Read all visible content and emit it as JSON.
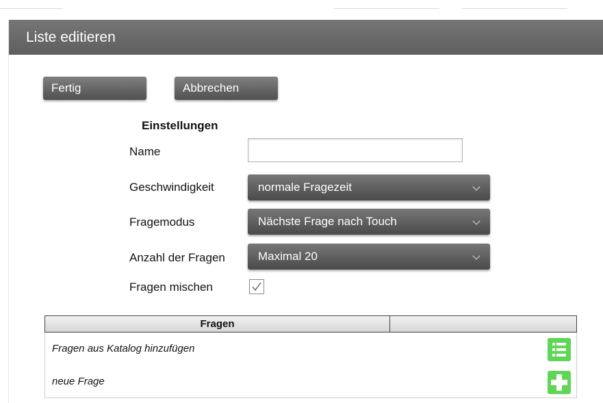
{
  "header": {
    "title": "Liste editieren"
  },
  "actions": {
    "done_label": "Fertig",
    "cancel_label": "Abbrechen"
  },
  "settings": {
    "heading": "Einstellungen",
    "name_label": "Name",
    "name_value": "",
    "speed_label": "Geschwindigkeit",
    "speed_value": "normale Fragezeit",
    "mode_label": "Fragemodus",
    "mode_value": "Nächste Frage nach Touch",
    "count_label": "Anzahl der Fragen",
    "count_value": "Maximal 20",
    "shuffle_label": "Fragen mischen",
    "shuffle_checked": true
  },
  "questions_table": {
    "column_header": "Fragen",
    "second_header": "",
    "rows": [
      {
        "label": "Fragen aus Katalog hinzufügen",
        "icon": "list-icon"
      },
      {
        "label": "neue Frage",
        "icon": "plus-icon"
      }
    ]
  },
  "colors": {
    "header_bg": "#666666",
    "button_bg": "#5e5e5e",
    "accent_green": "#5fd655"
  }
}
